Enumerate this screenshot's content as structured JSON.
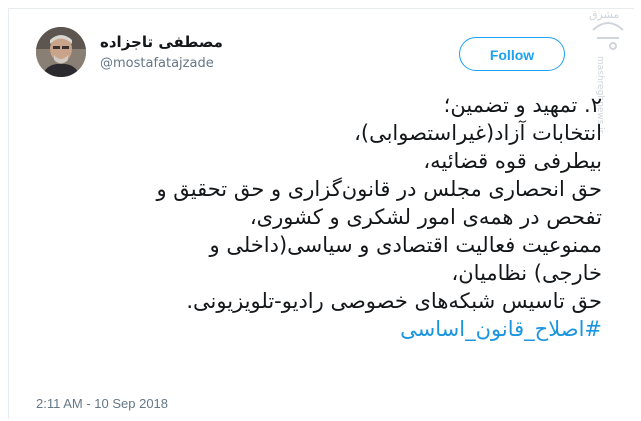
{
  "tweet": {
    "author_name": "مصطفی تاجزاده",
    "author_handle": "@mostafatajzade",
    "follow_label": "Follow",
    "lines": [
      "۲. تمهید و تضمین؛",
      "انتخابات آزاد(غیراستصوابی)،",
      "بیطرفی قوه قضائیه،",
      "حق انحصاری مجلس در قانون‌گزاری و حق تحقیق و",
      "تفحص در همه‌ی امور لشکری و کشوری،",
      "ممنوعیت فعالیت اقتصادی و سیاسی(داخلی و",
      "خارجی) نظامیان،",
      "حق تاسیس شبکه‌های خصوصی رادیو-تلویزیونی."
    ],
    "hashtag": "#اصلاح_قانون_اساسی",
    "timestamp": "2:11 AM - 10 Sep 2018"
  },
  "watermark": {
    "brand": "مشرق",
    "url": "mashreghnews.ir"
  },
  "colors": {
    "link": "#1b95e0",
    "follow_border": "#1da1f2",
    "text": "#14171a",
    "muted": "#657786"
  }
}
